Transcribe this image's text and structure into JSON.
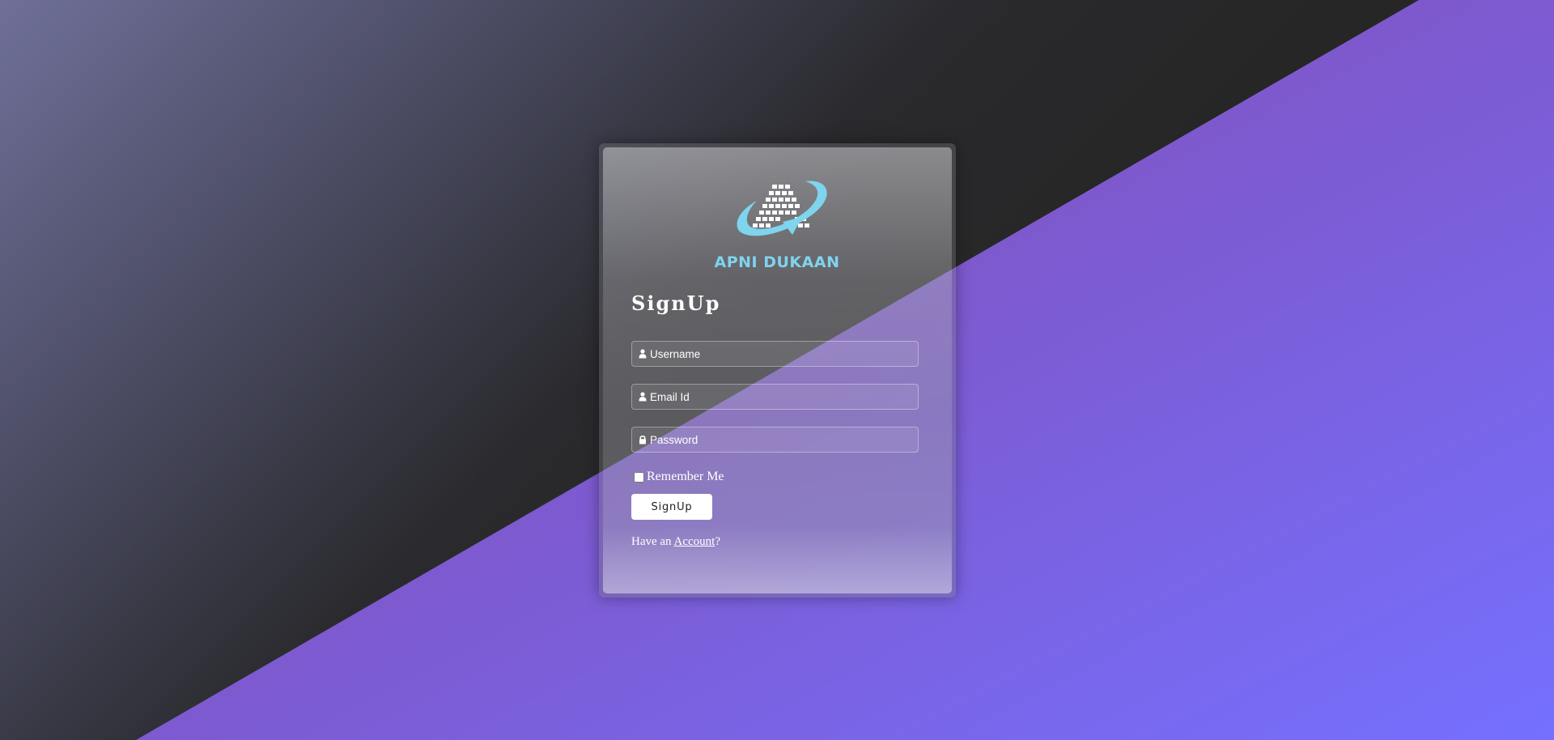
{
  "brand": {
    "name": "APNI DUKAAN",
    "color": "#7fd4ee"
  },
  "form": {
    "title": "SignUp",
    "username_placeholder": "Username",
    "email_placeholder": "Email Id",
    "password_placeholder": "Password",
    "remember_label": "Remember Me",
    "submit_label": "SignUp",
    "have_prefix": "Have an ",
    "account_link": "Account",
    "have_suffix": "?"
  },
  "icons": {
    "username": "user-icon",
    "email": "user-icon",
    "password": "lock-icon"
  },
  "colors": {
    "purple_light": "#7b6dff",
    "purple_dark": "#7f55c4",
    "dark_bg": "#262626"
  }
}
